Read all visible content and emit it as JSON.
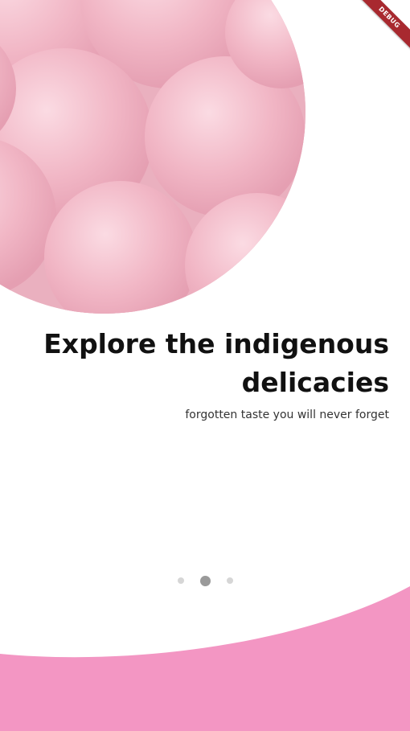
{
  "onboarding": {
    "title": "Explore the indigenous delicacies",
    "subtitle": "forgotten taste you will never forget",
    "page_indicator": {
      "total": 3,
      "active_index": 1
    }
  },
  "debug_banner": {
    "label": "DEBUG"
  },
  "colors": {
    "accent_pink": "#f396c3",
    "hero_pink": "#efb4c3",
    "text_dark": "#111111",
    "dot_inactive": "#d6d6d6",
    "dot_active": "#9a9a9a",
    "debug_red": "#a8292f"
  }
}
